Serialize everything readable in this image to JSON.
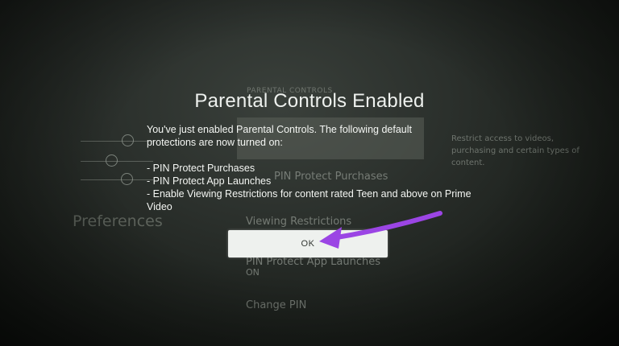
{
  "background_menu": {
    "header": "PARENTAL CONTROLS",
    "items": [
      "PIN Protect Purchases",
      "Viewing Restrictions",
      "PIN Protect App Launches",
      "ON",
      "Change PIN"
    ],
    "preferences_label": "Preferences",
    "description": "Restrict access to videos, purchasing and certain types of content."
  },
  "dialog": {
    "title": "Parental Controls Enabled",
    "intro": "You've just enabled Parental Controls. The following default protections are now turned on:",
    "bullets": [
      "- PIN Protect Purchases",
      "- PIN Protect App Launches",
      "- Enable Viewing Restrictions for content rated Teen and above on Prime Video"
    ],
    "ok_label": "OK"
  },
  "colors": {
    "arrow": "#9b45e4",
    "button_bg": "#eef1ee",
    "title_text": "#eef1ee"
  },
  "icons": {
    "navigation_nodes": "circle-node-icon",
    "annotation": "arrow-icon"
  }
}
